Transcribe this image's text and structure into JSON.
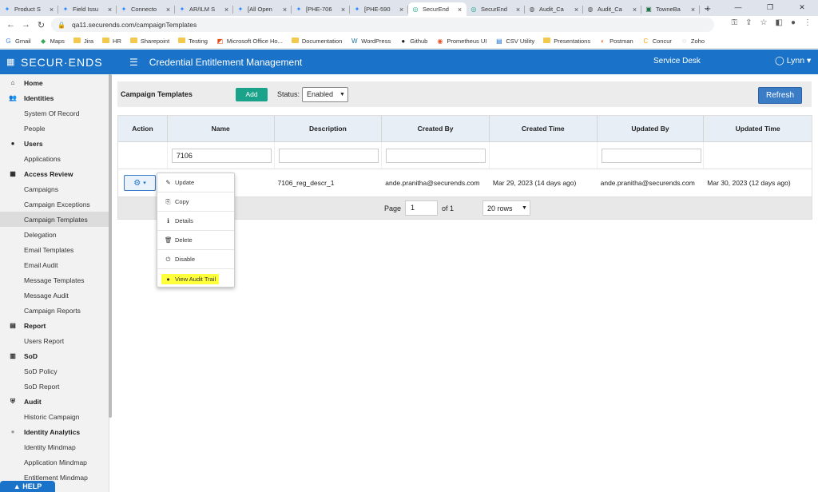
{
  "browser": {
    "tabs": [
      {
        "label": "Product S",
        "icon": "jira-icon"
      },
      {
        "label": "Field Issu",
        "icon": "jira-icon"
      },
      {
        "label": "Connecto",
        "icon": "jira-icon"
      },
      {
        "label": "AR/ILM S",
        "icon": "jira-icon"
      },
      {
        "label": "[All Open",
        "icon": "jira-icon"
      },
      {
        "label": "[PHE-706",
        "icon": "jira-icon"
      },
      {
        "label": "[PHE-590",
        "icon": "jira-icon"
      },
      {
        "label": "SecurEnd",
        "icon": "securends-icon"
      },
      {
        "label": "SecurEnd",
        "icon": "securends-icon"
      },
      {
        "label": "Audit_Ca",
        "icon": "globe-icon"
      },
      {
        "label": "Audit_Ca",
        "icon": "globe-icon"
      },
      {
        "label": "TowneBa",
        "icon": "excel-icon"
      }
    ],
    "active_tab": 7,
    "url": "qa11.securends.com/campaignTemplates",
    "bookmarks": [
      {
        "label": "Gmail",
        "icon": "google-icon"
      },
      {
        "label": "Maps",
        "icon": "maps-icon"
      },
      {
        "label": "Jira",
        "icon": "folder-icon"
      },
      {
        "label": "HR",
        "icon": "folder-icon"
      },
      {
        "label": "Sharepoint",
        "icon": "folder-icon"
      },
      {
        "label": "Testing",
        "icon": "folder-icon"
      },
      {
        "label": "Microsoft Office Ho...",
        "icon": "office-icon"
      },
      {
        "label": "Documentation",
        "icon": "folder-icon"
      },
      {
        "label": "WordPress",
        "icon": "wordpress-icon"
      },
      {
        "label": "Github",
        "icon": "github-icon"
      },
      {
        "label": "Prometheus UI",
        "icon": "prometheus-icon"
      },
      {
        "label": "CSV Utility",
        "icon": "csv-icon"
      },
      {
        "label": "Presentations",
        "icon": "folder-icon"
      },
      {
        "label": "Postman",
        "icon": "postman-icon"
      },
      {
        "label": "Concur",
        "icon": "concur-icon"
      },
      {
        "label": "Zoho",
        "icon": "zoho-icon"
      }
    ]
  },
  "header": {
    "logo": "SECUR·ENDS",
    "title": "Credential Entitlement Management",
    "service_desk": "Service Desk",
    "user": "Lynn"
  },
  "sidebar": {
    "sections": [
      {
        "label": "Home",
        "icon": "home-icon",
        "items": []
      },
      {
        "label": "Identities",
        "icon": "users-icon",
        "items": [
          "System Of Record",
          "People"
        ]
      },
      {
        "label": "Users",
        "icon": "user-icon",
        "items": [
          "Applications"
        ]
      },
      {
        "label": "Access Review",
        "icon": "grid-icon",
        "items": [
          "Campaigns",
          "Campaign Exceptions",
          "Campaign Templates",
          "Delegation",
          "Email Templates",
          "Email Audit",
          "Message Templates",
          "Message Audit",
          "Campaign Reports"
        ]
      },
      {
        "label": "Report",
        "icon": "report-icon",
        "items": [
          "Users Report"
        ]
      },
      {
        "label": "SoD",
        "icon": "table-icon",
        "items": [
          "SoD Policy",
          "SoD Report"
        ]
      },
      {
        "label": "Audit",
        "icon": "shield-icon",
        "items": [
          "Historic Campaign"
        ]
      },
      {
        "label": "Identity Analytics",
        "icon": "circle-icon",
        "items": [
          "Identity Mindmap",
          "Application Mindmap",
          "Entitlement Mindmap"
        ]
      }
    ],
    "active_item": "Campaign Templates",
    "help": "HELP"
  },
  "toolbar": {
    "title": "Campaign Templates",
    "add_label": "Add",
    "status_label": "Status:",
    "status_value": "Enabled",
    "refresh_label": "Refresh"
  },
  "table": {
    "columns": [
      "Action",
      "Name",
      "Description",
      "Created By",
      "Created Time",
      "Updated By",
      "Updated Time"
    ],
    "filters": {
      "name": "7106",
      "description": "",
      "created_by": "",
      "updated_by": ""
    },
    "rows": [
      {
        "name": "",
        "description": "7106_reg_descr_1",
        "created_by": "ande.pranitha@securends.com",
        "created_time": "Mar 29, 2023 (14 days ago)",
        "updated_by": "ande.pranitha@securends.com",
        "updated_time": "Mar 30, 2023 (12 days ago)"
      }
    ],
    "pager": {
      "page_label": "Page",
      "page": "1",
      "of_label": "of 1",
      "rows_per_page": "20 rows"
    }
  },
  "action_menu": [
    {
      "label": "Update",
      "icon": "edit-icon"
    },
    {
      "label": "Copy",
      "icon": "copy-icon"
    },
    {
      "label": "Details",
      "icon": "info-icon"
    },
    {
      "label": "Delete",
      "icon": "trash-icon"
    },
    {
      "label": "Disable",
      "icon": "power-icon"
    },
    {
      "label": "View Audit Trail",
      "icon": "info-circle-icon",
      "highlighted": true
    }
  ],
  "colors": {
    "primary": "#1a73c9",
    "add_button": "#1aa38a",
    "highlight": "#ffff3b"
  }
}
